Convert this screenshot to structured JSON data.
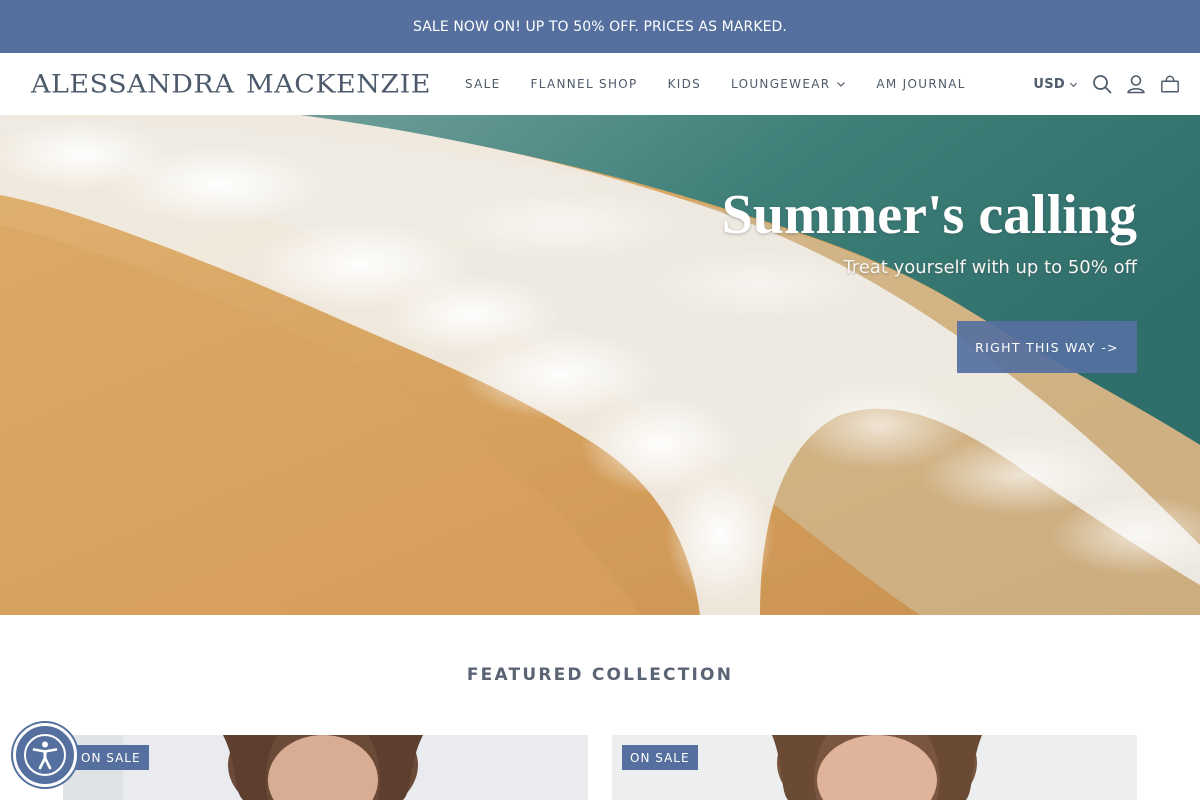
{
  "announcement": {
    "text": "SALE NOW ON! UP TO 50% OFF. PRICES AS MARKED."
  },
  "header": {
    "logo": {
      "word1": "ALESSANDRA",
      "word2": "MACKENZIE"
    },
    "nav": [
      {
        "label": "SALE",
        "has_dropdown": false
      },
      {
        "label": "FLANNEL SHOP",
        "has_dropdown": false
      },
      {
        "label": "KIDS",
        "has_dropdown": false
      },
      {
        "label": "LOUNGEWEAR",
        "has_dropdown": true
      },
      {
        "label": "AM JOURNAL",
        "has_dropdown": false
      }
    ],
    "currency": "USD",
    "icons": [
      "search-icon",
      "account-icon",
      "cart-icon"
    ]
  },
  "hero": {
    "title": "Summer's calling",
    "subtitle": "Treat yourself with up to 50% off",
    "cta": "RIGHT THIS WAY ->"
  },
  "featured": {
    "title": "FEATURED COLLECTION",
    "products": [
      {
        "badge": "ON SALE"
      },
      {
        "badge": "ON SALE"
      }
    ]
  },
  "colors": {
    "brand": "#55709f",
    "text": "#4e5b6b",
    "sand": "#d9a866",
    "sea": "#3f7d74"
  }
}
